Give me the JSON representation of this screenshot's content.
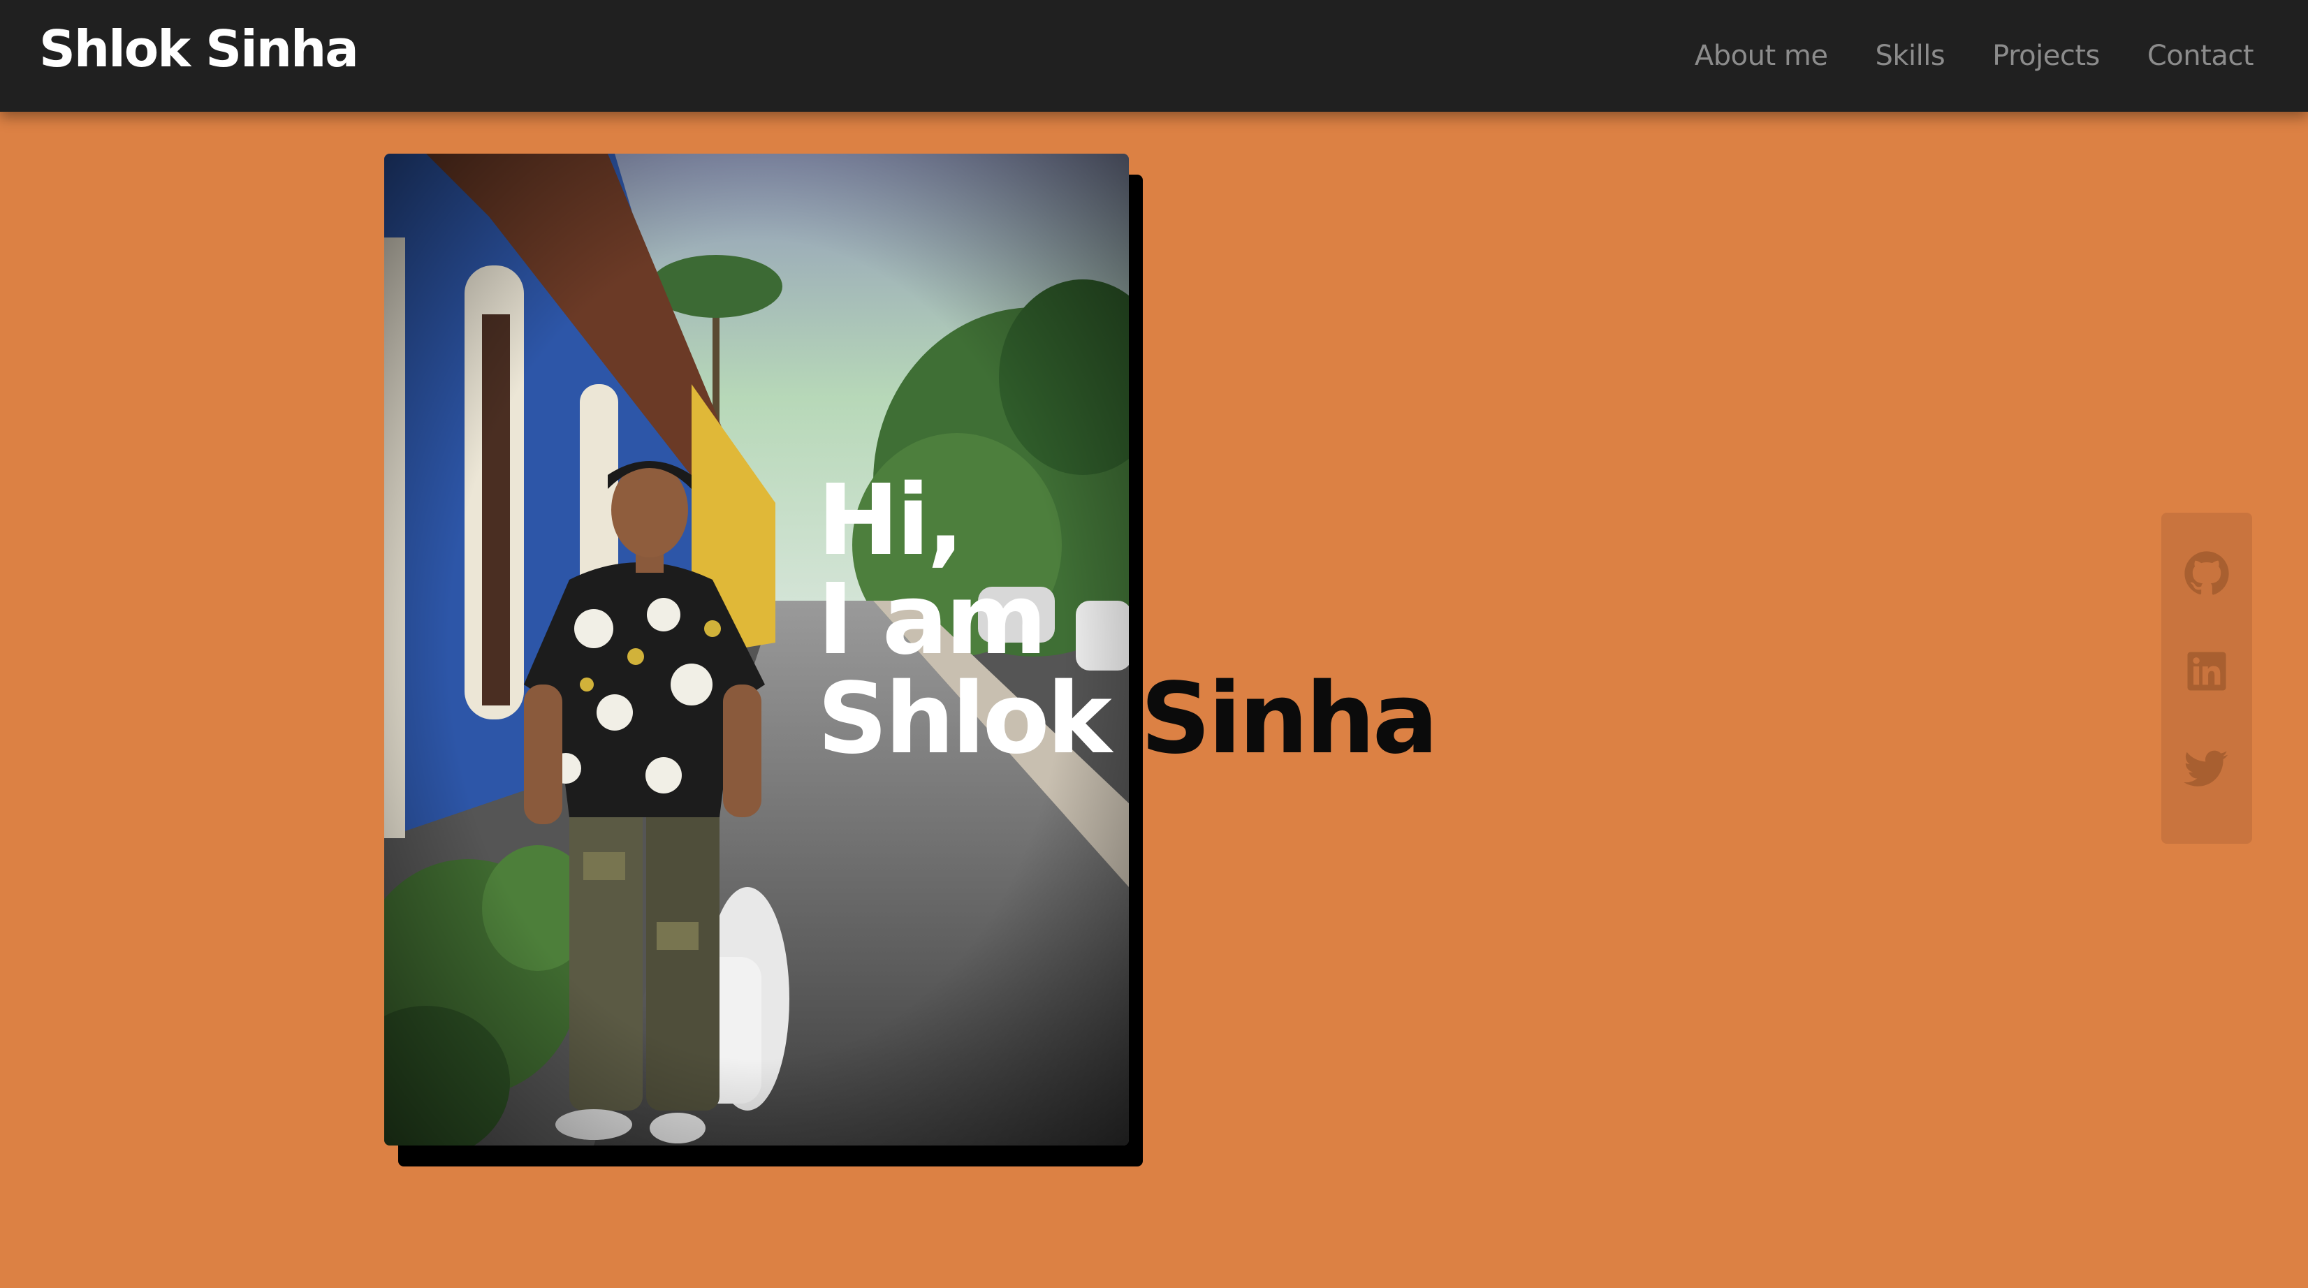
{
  "brand": {
    "name": "Shlok Sinha"
  },
  "nav": {
    "items": [
      {
        "label": "About me"
      },
      {
        "label": "Skills"
      },
      {
        "label": "Projects"
      },
      {
        "label": "Contact"
      }
    ]
  },
  "hero": {
    "line1": "Hi,",
    "line2": "I am",
    "first_name": "Shlok",
    "last_name": "Sinha"
  },
  "photo": {
    "alt": "Portrait of Shlok Sinha standing on a street"
  },
  "social": {
    "items": [
      {
        "icon": "github-icon"
      },
      {
        "icon": "linkedin-icon"
      },
      {
        "icon": "twitter-icon"
      }
    ]
  },
  "colors": {
    "background": "#dc8144",
    "navbar": "#202020",
    "nav_text": "#8c8c8c",
    "brand_text": "#ffffff",
    "social_panel": "#c9743e",
    "social_icon": "#a85f30"
  }
}
